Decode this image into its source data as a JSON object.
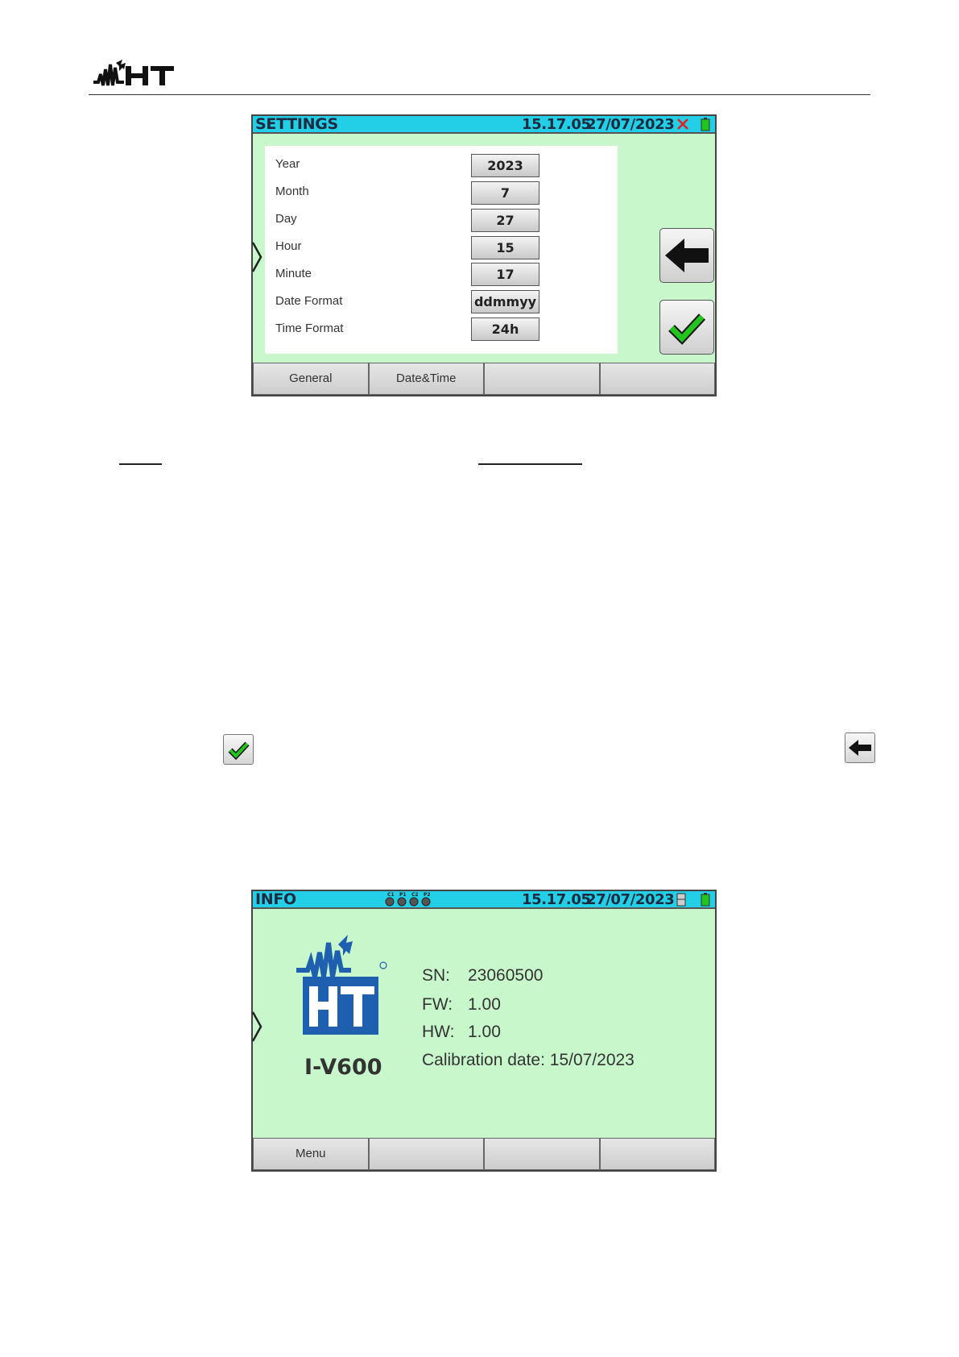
{
  "header": {
    "logo": "HT",
    "logo_icon": "ht-logo-icon"
  },
  "settings_screen": {
    "title": "SETTINGS",
    "time": "15.17.05",
    "date": "27/07/2023",
    "status_icons": [
      "close-icon",
      "battery-icon"
    ],
    "fields": [
      {
        "label": "Year",
        "value": "2023"
      },
      {
        "label": "Month",
        "value": "7"
      },
      {
        "label": "Day",
        "value": "27"
      },
      {
        "label": "Hour",
        "value": "15"
      },
      {
        "label": "Minute",
        "value": "17"
      },
      {
        "label": "Date Format",
        "value": "ddmmyy"
      },
      {
        "label": "Time Format",
        "value": "24h"
      }
    ],
    "tabs": [
      "General",
      "Date&Time",
      "",
      ""
    ]
  },
  "info_screen": {
    "title": "INFO",
    "probe_labels": [
      "C1",
      "P1",
      "C2",
      "P2"
    ],
    "time": "15.17.05",
    "date": "27/07/2023",
    "model": "I-V600",
    "sn_label": "SN:",
    "sn_value": "23060500",
    "fw_label": "FW:",
    "fw_value": "1.00",
    "hw_label": "HW:",
    "hw_value": "1.00",
    "calibration": "Calibration date: 15/07/2023",
    "tabs": [
      "Menu",
      "",
      "",
      ""
    ]
  },
  "colors": {
    "title_bar": "#23cfe6",
    "screen_bg": "#c8f7cc",
    "logo_blue": "#1f5fb0",
    "check_green": "#22c41e",
    "close_red": "#e02020"
  }
}
